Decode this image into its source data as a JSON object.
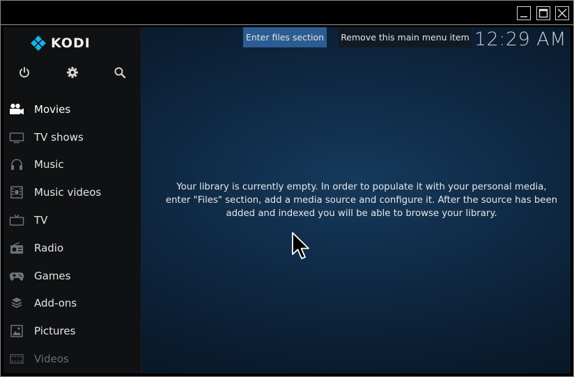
{
  "window": {
    "controls": [
      {
        "name": "minimize",
        "icon": "minimize-icon"
      },
      {
        "name": "maximize",
        "icon": "maximize-icon"
      },
      {
        "name": "close",
        "icon": "close-icon"
      }
    ]
  },
  "header": {
    "logo_text": "KODI",
    "clock": "12:29 AM"
  },
  "toolbar": {
    "icons": [
      "power-icon",
      "gear-icon",
      "search-icon"
    ]
  },
  "sidebar": {
    "items": [
      {
        "label": "Movies",
        "icon": "movie-camera-icon",
        "active": true
      },
      {
        "label": "TV shows",
        "icon": "tv-icon"
      },
      {
        "label": "Music",
        "icon": "headphones-icon"
      },
      {
        "label": "Music videos",
        "icon": "film-strip-icon"
      },
      {
        "label": "TV",
        "icon": "tv-antenna-icon"
      },
      {
        "label": "Radio",
        "icon": "radio-icon"
      },
      {
        "label": "Games",
        "icon": "gamepad-icon"
      },
      {
        "label": "Add-ons",
        "icon": "addons-box-icon"
      },
      {
        "label": "Pictures",
        "icon": "picture-icon"
      },
      {
        "label": "Videos",
        "icon": "video-icon",
        "dim": true
      }
    ]
  },
  "main": {
    "message": "Your library is currently empty. In order to populate it with your personal media, enter \"Files\" section, add a media source and configure it. After the source has been added and indexed you will be able to browse your library.",
    "enter_files_label": "Enter files section",
    "remove_item_label": "Remove this main menu item"
  },
  "colors": {
    "accent": "#2b5d92",
    "kodi_blue": "#17b2e7",
    "sidebar_bg": "#0f1113",
    "background": "#0f2a45"
  }
}
